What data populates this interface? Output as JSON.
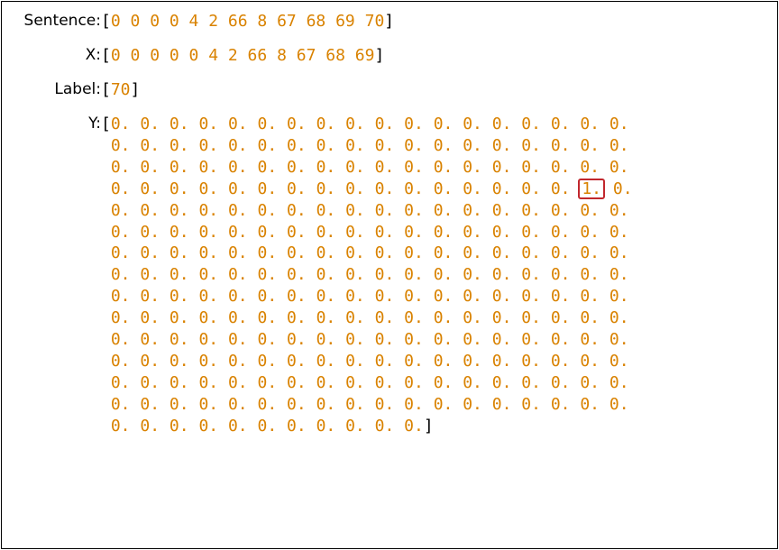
{
  "labels": {
    "sentence": "Sentence:",
    "x": "X:",
    "label": "Label:",
    "y": "Y:"
  },
  "sentence": [
    0,
    0,
    0,
    0,
    4,
    2,
    66,
    8,
    67,
    68,
    69,
    70
  ],
  "x": [
    0,
    0,
    0,
    0,
    0,
    4,
    2,
    66,
    8,
    67,
    68,
    69
  ],
  "label": [
    70
  ],
  "y": {
    "rows": 15,
    "cols_full": 18,
    "last_row_cols": 11,
    "highlight": {
      "row": 3,
      "col": 16,
      "value": "1."
    },
    "fill": "0."
  }
}
